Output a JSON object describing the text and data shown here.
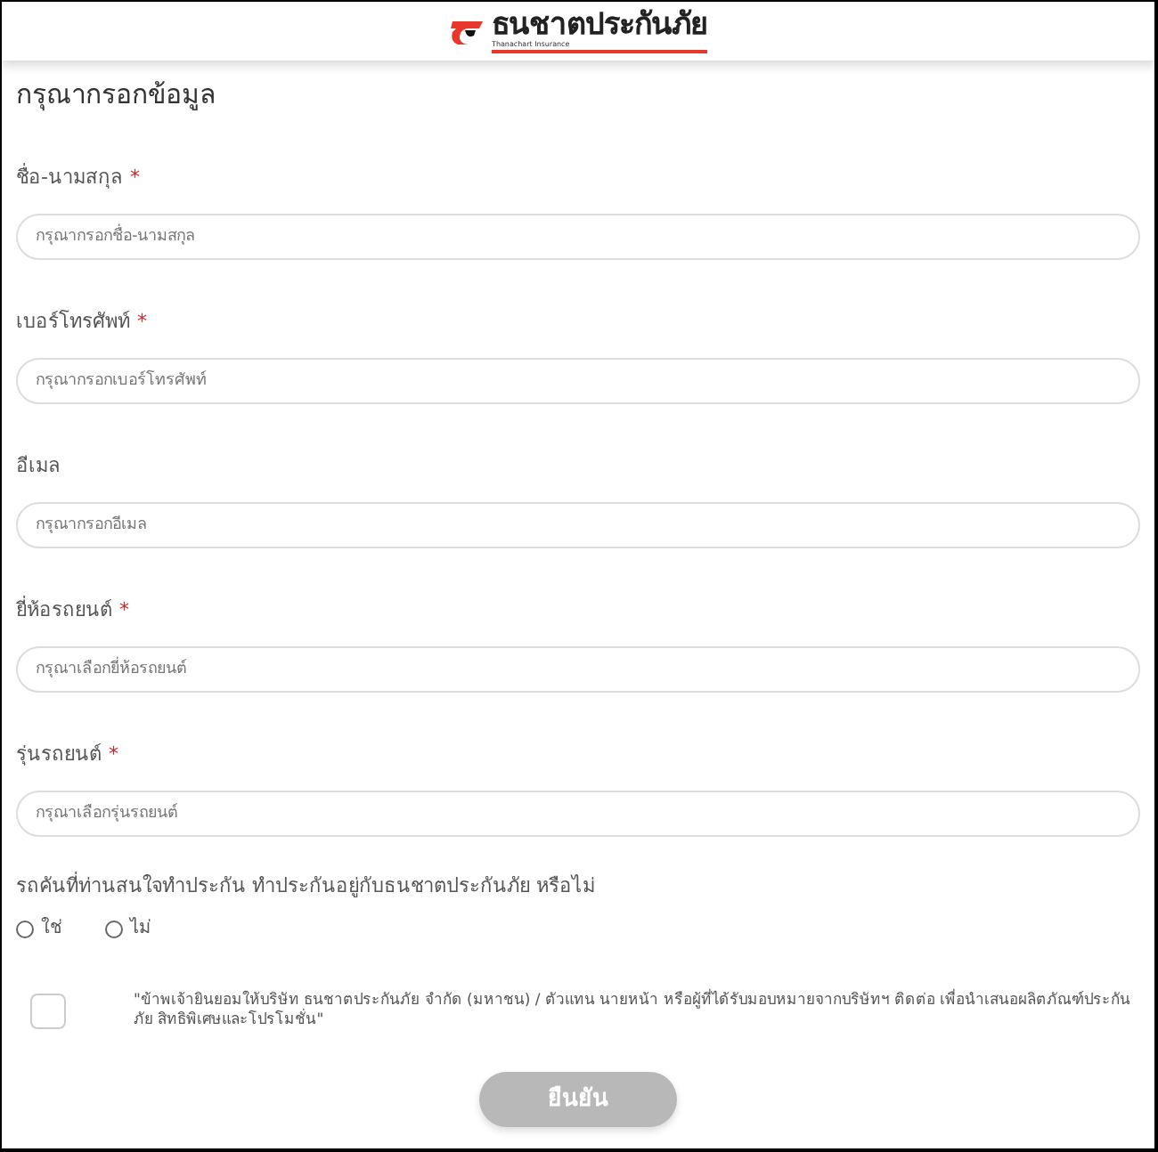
{
  "header": {
    "logo_text": "ธนชาตประกันภัย",
    "logo_subtext": "Thanachart Insurance"
  },
  "title": "กรุณากรอกข้อมูล",
  "fields": [
    {
      "label": "ชื่อ-นามสกุล",
      "required_mark": "*",
      "placeholder": "กรุณากรอกชื่อ-นามสกุล"
    },
    {
      "label": "เบอร์โทรศัพท์",
      "required_mark": "*",
      "placeholder": "กรุณากรอกเบอร์โทรศัพท์"
    },
    {
      "label": "อีเมล",
      "placeholder": "กรุณากรอกอีเมล"
    },
    {
      "label": "ยี่ห้อรถยนต์",
      "required_mark": "*",
      "placeholder": "กรุณาเลือกยี่ห้อรถยนต์"
    },
    {
      "label": "รุ่นรถยนต์",
      "required_mark": "*",
      "placeholder": "กรุณาเลือกรุ่นรถยนต์"
    }
  ],
  "question": {
    "text": "รถคันที่ท่านสนใจทำประกัน ทำประกันอยู่กับธนชาตประกันภัย หรือไม่",
    "options": [
      {
        "label": "ใช่",
        "selected": false
      },
      {
        "label": "ไม่",
        "selected": false
      }
    ]
  },
  "consent": {
    "checked": false,
    "text": "\"ข้าพเจ้ายินยอมให้บริษัท ธนชาตประกันภัย จำกัด (มหาชน) / ตัวแทน นายหน้า หรือผู้ที่ได้รับมอบหมายจากบริษัทฯ ติดต่อ เพื่อนำเสนอผลิตภัณฑ์ประกันภัย สิทธิพิเศษและโปรโมชั่น\""
  },
  "submit": {
    "label": "ยืนยัน",
    "disabled": true
  }
}
